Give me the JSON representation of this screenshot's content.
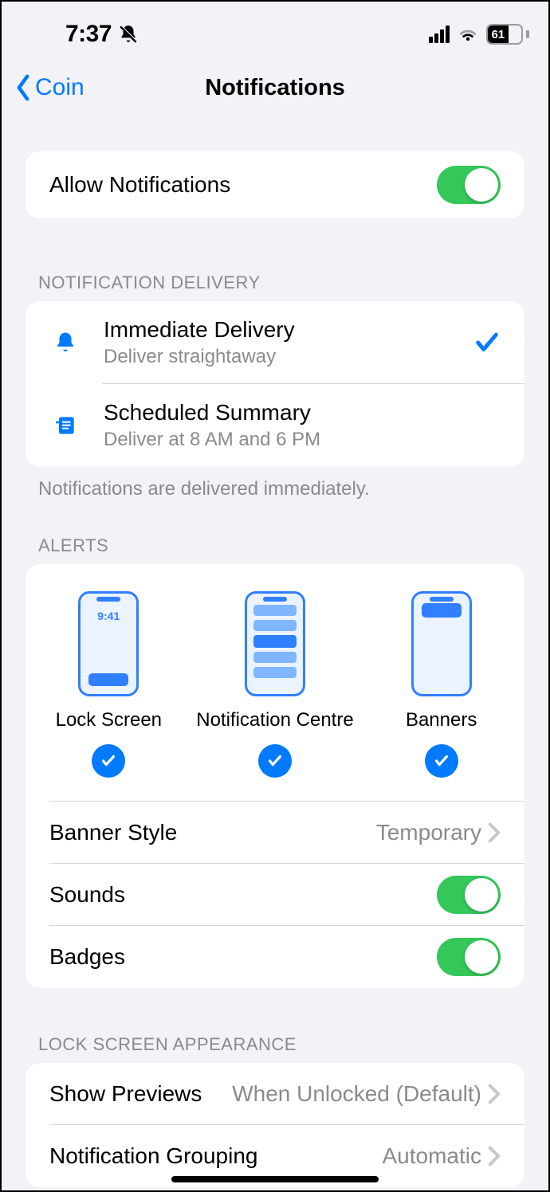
{
  "status": {
    "time": "7:37",
    "battery_pct": "61"
  },
  "nav": {
    "back_label": "Coin",
    "title": "Notifications"
  },
  "allow": {
    "label": "Allow Notifications",
    "on": true
  },
  "delivery": {
    "header": "NOTIFICATION DELIVERY",
    "footer": "Notifications are delivered immediately.",
    "options": [
      {
        "title": "Immediate Delivery",
        "subtitle": "Deliver straightaway",
        "selected": true
      },
      {
        "title": "Scheduled Summary",
        "subtitle": "Deliver at 8 AM and 6 PM",
        "selected": false
      }
    ]
  },
  "alerts": {
    "header": "ALERTS",
    "preview_time": "9:41",
    "types": [
      {
        "label": "Lock Screen",
        "checked": true
      },
      {
        "label": "Notification Centre",
        "checked": true
      },
      {
        "label": "Banners",
        "checked": true
      }
    ],
    "banner_style": {
      "label": "Banner Style",
      "value": "Temporary"
    },
    "sounds": {
      "label": "Sounds",
      "on": true
    },
    "badges": {
      "label": "Badges",
      "on": true
    }
  },
  "lock_screen": {
    "header": "LOCK SCREEN APPEARANCE",
    "previews": {
      "label": "Show Previews",
      "value": "When Unlocked (Default)"
    },
    "grouping": {
      "label": "Notification Grouping",
      "value": "Automatic"
    }
  }
}
